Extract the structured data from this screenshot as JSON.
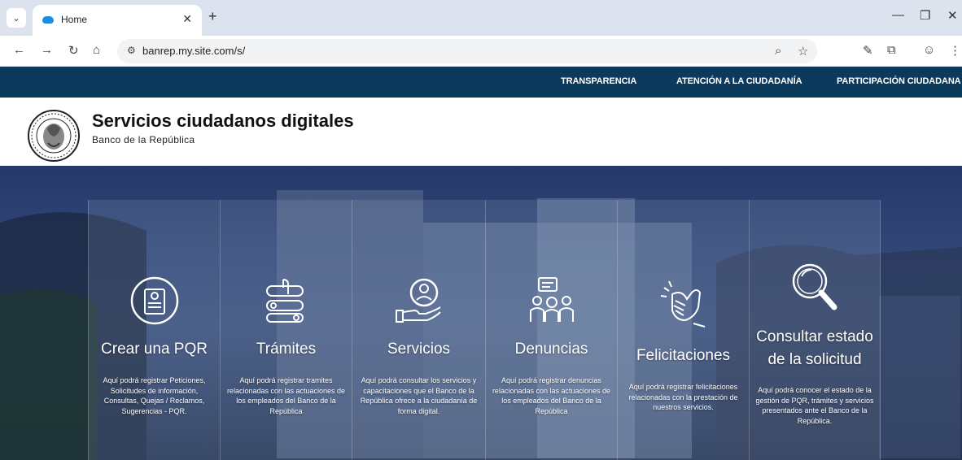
{
  "browser": {
    "tab_title": "Home",
    "url": "banrep.my.site.com/s/"
  },
  "topnav": {
    "items": [
      "TRANSPARENCIA",
      "ATENCIÓN A LA CIUDADANÍA",
      "PARTICIPACIÓN CIUDADANA"
    ]
  },
  "header": {
    "title": "Servicios ciudadanos digitales",
    "subtitle": "Banco de la República",
    "logo_text": "BANCO DE LA REPÚBLICA · COLOMBIA"
  },
  "cards": [
    {
      "title": "Crear una PQR",
      "icon": "pqr-form-icon",
      "description": "Aquí podrá registrar Peticiones, Solicitudes de información, Consultas, Quejas / Reclamos, Sugerencias - PQR."
    },
    {
      "title": "Trámites",
      "icon": "tramites-hand-icon",
      "description": "Aquí podrá registrar tramites relacionadas con las actuaciones de los empleados del Banco de la República"
    },
    {
      "title": "Servicios",
      "icon": "service-hand-icon",
      "description": "Aquí podrá consultar los servicios y capacitaciones que el Banco de la República ofrece a la ciudadanía de forma digital."
    },
    {
      "title": "Denuncias",
      "icon": "people-alert-icon",
      "description": "Aquí podrá registrar denuncias relacionadas con las actuaciones de los empleados del Banco de la República"
    },
    {
      "title": "Felicitaciones",
      "icon": "clapping-hands-icon",
      "description": "Aquí podrá registrar felicitaciones relacionadas con la prestación de nuestros servicios."
    },
    {
      "title": "Consultar estado de la solicitud",
      "icon": "magnifier-icon",
      "description": "Aquí podrá conocer el estado de la gestión de PQR, trámites y servicios presentados ante el Banco de la República."
    }
  ],
  "colors": {
    "topnav_bg": "#0b3a5c",
    "hero_bg": "#314777"
  }
}
